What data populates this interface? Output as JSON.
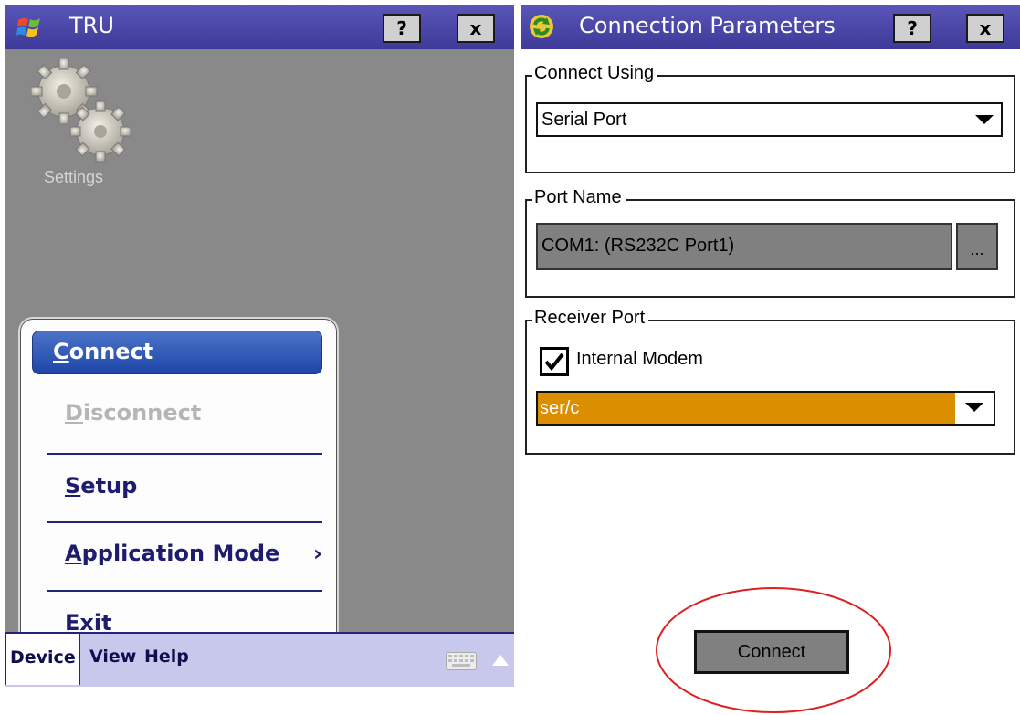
{
  "left_window": {
    "title": "TRU",
    "help_label": "?",
    "close_label": "x",
    "desktop_icons": [
      {
        "label": "Settings",
        "icon": "gears-icon"
      }
    ],
    "menu": {
      "items": [
        {
          "label": "Connect",
          "state": "selected"
        },
        {
          "label": "Disconnect",
          "state": "disabled"
        },
        {
          "label": "Setup",
          "state": "normal"
        },
        {
          "label": "Application Mode",
          "state": "normal",
          "submenu": true
        },
        {
          "label": "Exit",
          "state": "normal"
        }
      ],
      "submenu_arrow": "›"
    },
    "taskbar": {
      "items": [
        "Device",
        "View",
        "Help"
      ],
      "active": "Device"
    }
  },
  "right_window": {
    "title": "Connection Parameters",
    "help_label": "?",
    "close_label": "x",
    "connect_using": {
      "label": "Connect Using",
      "value": "Serial Port"
    },
    "port_name": {
      "label": "Port Name",
      "value": "COM1: (RS232C Port1)",
      "browse_label": "..."
    },
    "receiver_port": {
      "label": "Receiver Port",
      "checkbox_label": "Internal Modem",
      "checked": true,
      "value": "ser/c"
    },
    "connect_button": "Connect"
  },
  "colors": {
    "title_bar": "#4a47a8",
    "desktop": "#898989",
    "menu_highlight": "#2a54b4",
    "highlighted_field": "#db8e00",
    "annotation_circle": "#e02020"
  }
}
